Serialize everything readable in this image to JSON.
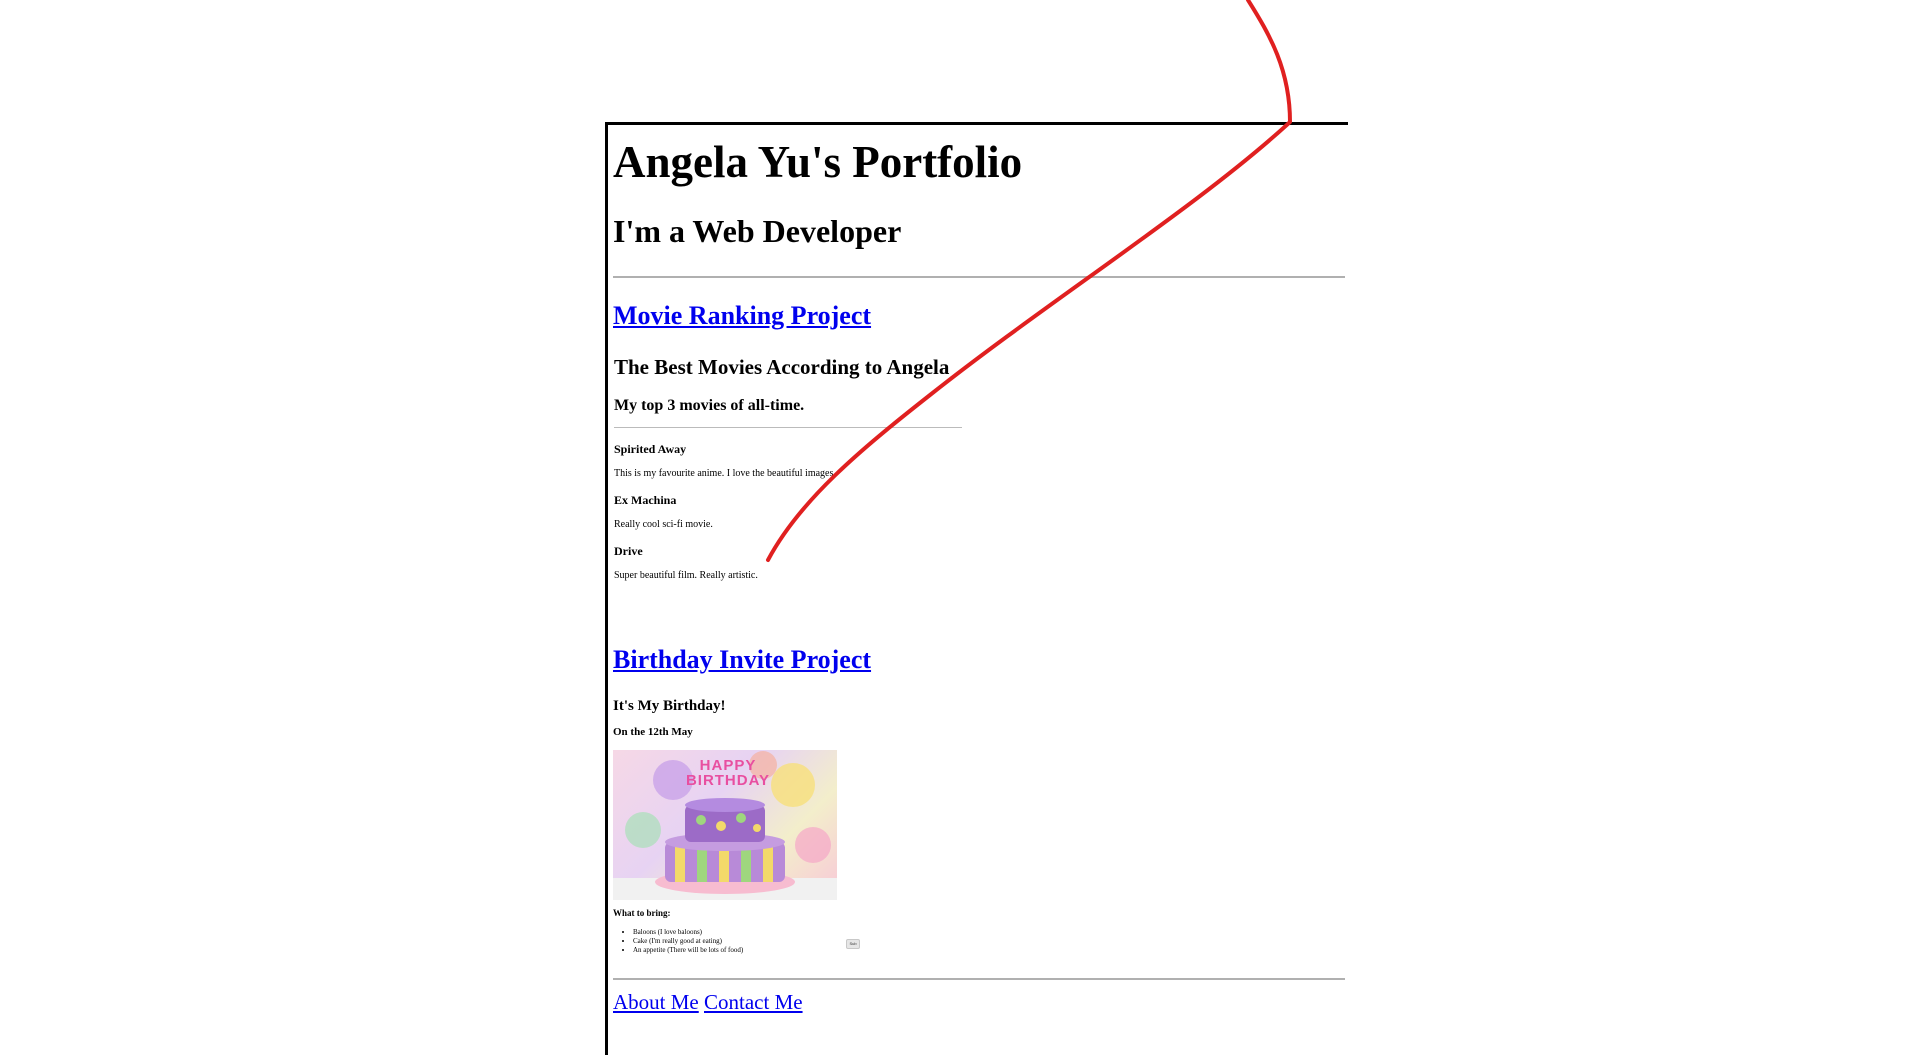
{
  "portfolio": {
    "title": "Angela Yu's Portfolio",
    "subtitle": "I'm a Web Developer"
  },
  "movie_project": {
    "link_text": "Movie Ranking Project",
    "page_title": "The Best Movies According to Angela",
    "page_subtitle": "My top 3 movies of all-time.",
    "movies": [
      {
        "title": "Spirited Away",
        "description": "This is my favourite anime. I love the beautiful images."
      },
      {
        "title": "Ex Machina",
        "description": "Really cool sci-fi movie."
      },
      {
        "title": "Drive",
        "description": "Super beautiful film. Really artistic."
      }
    ]
  },
  "birthday_project": {
    "link_text": "Birthday Invite Project",
    "heading": "It's My Birthday!",
    "date": "On the 12th May",
    "image_text": "HAPPY BIRTHDAY",
    "bring_heading": "What to bring:",
    "bring_items": [
      "Baloons (I love baloons)",
      "Cake (I'm really good at eating)",
      "An appetite (There will be lots of food)"
    ],
    "button_label": "Sub"
  },
  "footer": {
    "about_link": "About Me",
    "contact_link": "Contact Me"
  },
  "colors": {
    "link": "#0000ee",
    "annotation_stroke": "#e02020",
    "rule": "#b0b0b0"
  }
}
